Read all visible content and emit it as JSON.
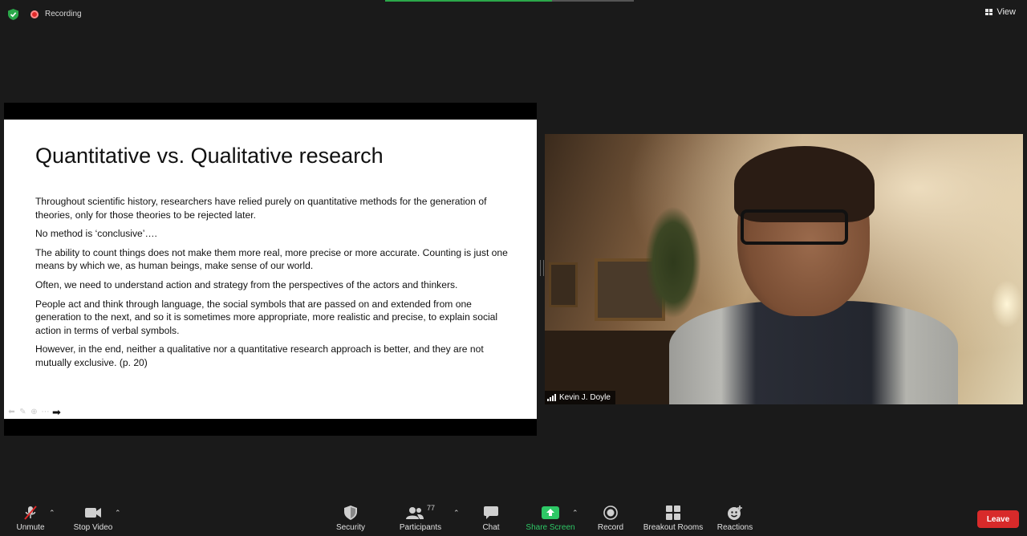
{
  "topbar": {
    "recording_label": "Recording",
    "view_label": "View"
  },
  "slide": {
    "title": "Quantitative vs. Qualitative research",
    "paragraphs": [
      "Throughout scientific history, researchers have relied purely on quantitative methods for the generation of theories, only for those theories to be rejected later.",
      "No method is ‘conclusive’….",
      "The ability to count things does not make them more real, more precise or more accurate. Counting is just one means by which we, as human beings, make sense of our world.",
      "Often, we need to understand action and strategy from the perspectives of the actors and thinkers.",
      "People act and think through language, the social symbols that are passed on and extended from one generation to the next, and so it is sometimes more appropriate, more realistic and precise, to explain social action in terms of verbal symbols.",
      "However, in the end, neither a qualitative nor a quantitative research approach is better, and they are not mutually exclusive. (p. 20)"
    ]
  },
  "participant": {
    "name": "Kevin J. Doyle"
  },
  "toolbar": {
    "unmute": "Unmute",
    "stop_video": "Stop Video",
    "security": "Security",
    "participants": "Participants",
    "participants_count": "77",
    "chat": "Chat",
    "share_screen": "Share Screen",
    "record": "Record",
    "breakout_rooms": "Breakout Rooms",
    "reactions": "Reactions",
    "leave": "Leave"
  },
  "colors": {
    "share_green": "#2ec866",
    "leave_red": "#d82a2a",
    "recording_red": "#e02828",
    "shield_green": "#2ba84a"
  }
}
